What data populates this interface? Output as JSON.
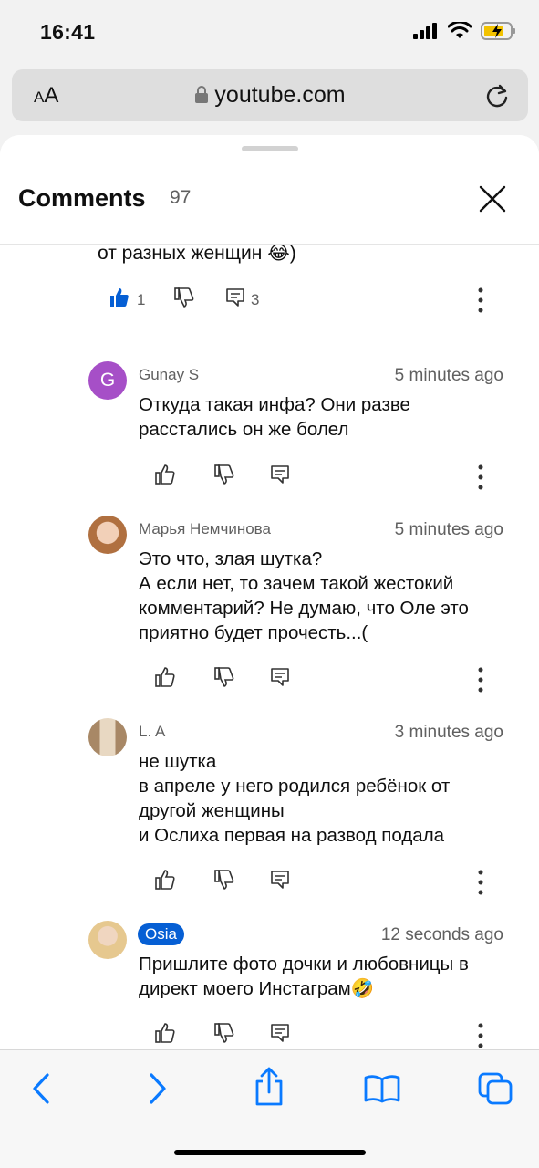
{
  "status": {
    "time": "16:41"
  },
  "urlbar": {
    "aa_label_big": "A",
    "aa_label_small": "A",
    "host": "youtube.com"
  },
  "sheet": {
    "title": "Comments",
    "count": "97"
  },
  "partial": {
    "text": "от разных женщин 😂)",
    "likes": "1",
    "replies": "3"
  },
  "comments": [
    {
      "author": "Gunay S",
      "avatar_letter": "G",
      "avatar_color": "#a64fc7",
      "time": "5 minutes ago",
      "text": "Откуда такая инфа? Они разве\nрасстались он же болел"
    },
    {
      "author": "Марья Немчинова",
      "time": "5 minutes ago",
      "text": "Это что, злая шутка?\nА если нет, то зачем такой жестокий\nкомментарий? Не думаю, что Оле это\nприятно будет прочесть...("
    },
    {
      "author": "L. A",
      "time": "3 minutes ago",
      "text": "не шутка\nв апреле у него родился ребёнок от\nдругой женщины\nи Ослиха первая на развод подала"
    },
    {
      "author": "Osia",
      "time": "12 seconds ago",
      "text": "Пришлите фото дочки и любовницы в\nдирект моего Инстаграм🤣"
    }
  ],
  "colors": {
    "accent": "#065fd4",
    "safari_blue": "#0a7aff"
  }
}
